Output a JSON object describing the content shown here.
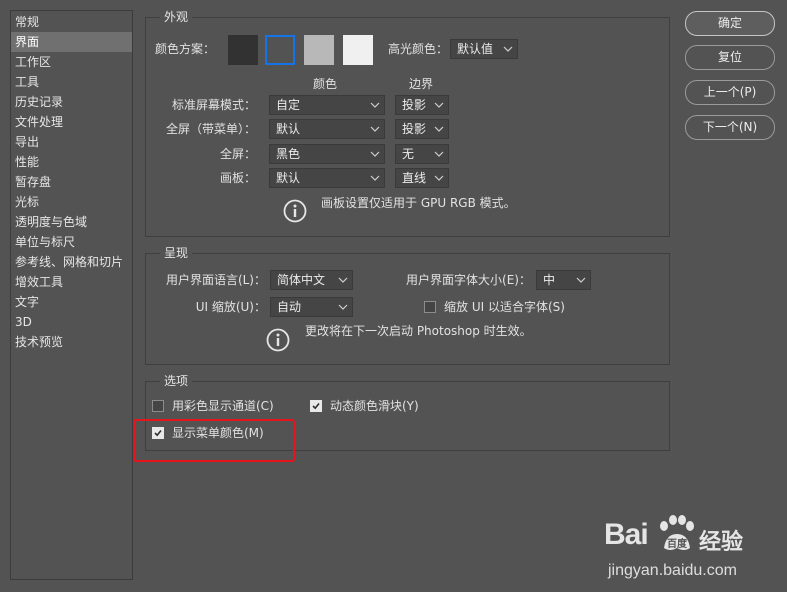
{
  "sidebar": {
    "items": [
      "常规",
      "界面",
      "工作区",
      "工具",
      "历史记录",
      "文件处理",
      "导出",
      "性能",
      "暂存盘",
      "光标",
      "透明度与色域",
      "单位与标尺",
      "参考线、网格和切片",
      "增效工具",
      "文字",
      "3D",
      "技术预览"
    ],
    "selected_index": 1
  },
  "buttons": {
    "ok": "确定",
    "reset": "复位",
    "prev": "上一个(P)",
    "next": "下一个(N)"
  },
  "appearance": {
    "title": "外观",
    "color_scheme_label": "颜色方案：",
    "highlight_label": "高光颜色：",
    "highlight_value": "默认值",
    "col_color": "颜色",
    "col_border": "边界",
    "rows": [
      {
        "label": "标准屏幕模式：",
        "color": "自定",
        "border": "投影"
      },
      {
        "label": "全屏（带菜单）：",
        "color": "默认",
        "border": "投影"
      },
      {
        "label": "全屏：",
        "color": "黑色",
        "border": "无"
      },
      {
        "label": "画板：",
        "color": "默认",
        "border": "直线"
      }
    ],
    "info_text": "画板设置仅适用于 GPU RGB 模式。",
    "swatch_colors": [
      "#323232",
      "#535353",
      "#b8b8b8",
      "#f0f0f0"
    ],
    "swatch_selected_border": "#1473e6"
  },
  "presentation": {
    "title": "呈现",
    "ui_lang_label": "用户界面语言(L)：",
    "ui_lang_value": "简体中文",
    "ui_font_label": "用户界面字体大小(E)：",
    "ui_font_value": "中",
    "ui_scale_label": "UI 缩放(U)：",
    "ui_scale_value": "自动",
    "scale_fit_label": "缩放 UI 以适合字体(S)",
    "scale_fit_checked": false,
    "info_text": "更改将在下一次启动 Photoshop 时生效。"
  },
  "options": {
    "title": "选项",
    "color_channels_label": "用彩色显示通道(C)",
    "color_channels_checked": false,
    "dynamic_sliders_label": "动态颜色滑块(Y)",
    "dynamic_sliders_checked": true,
    "menu_colors_label": "显示菜单颜色(M)",
    "menu_colors_checked": true
  },
  "annotation": {
    "highlight_color": "#e8141c"
  },
  "watermark": {
    "brand": "Bai",
    "brand2": "百度",
    "suffix": "经验",
    "url": "jingyan.baidu.com"
  }
}
